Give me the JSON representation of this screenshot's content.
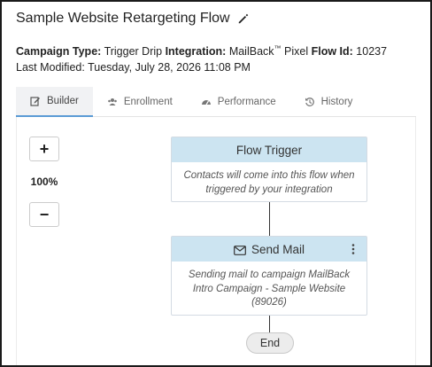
{
  "header": {
    "title": "Sample Website Retargeting Flow",
    "edit_icon": "pencil-icon"
  },
  "meta": {
    "campaign_type_label": "Campaign Type:",
    "campaign_type": "Trigger Drip",
    "integration_label": "Integration:",
    "integration_name": "MailBack",
    "integration_tm": "™",
    "integration_suffix": "Pixel",
    "flow_id_label": "Flow Id:",
    "flow_id": "10237",
    "last_modified": "Last Modified: Tuesday, July 28, 2026 11:08 PM"
  },
  "tabs": [
    {
      "label": "Builder",
      "icon": "edit-icon",
      "active": true
    },
    {
      "label": "Enrollment",
      "icon": "users-icon",
      "active": false
    },
    {
      "label": "Performance",
      "icon": "gauge-icon",
      "active": false
    },
    {
      "label": "History",
      "icon": "history-icon",
      "active": false
    }
  ],
  "zoom": {
    "plus": "+",
    "minus": "−",
    "level": "100%"
  },
  "flow": {
    "trigger": {
      "title": "Flow Trigger",
      "body": "Contacts will come into this flow when triggered by your integration"
    },
    "send_mail": {
      "title": "Send Mail",
      "icon": "envelope-icon",
      "body": "Sending mail to campaign MailBack Intro Campaign - Sample Website (89026)"
    },
    "end": {
      "label": "End"
    }
  },
  "colors": {
    "node_header": "#cce4f1",
    "active_tab_underline": "#5b9bd5"
  }
}
